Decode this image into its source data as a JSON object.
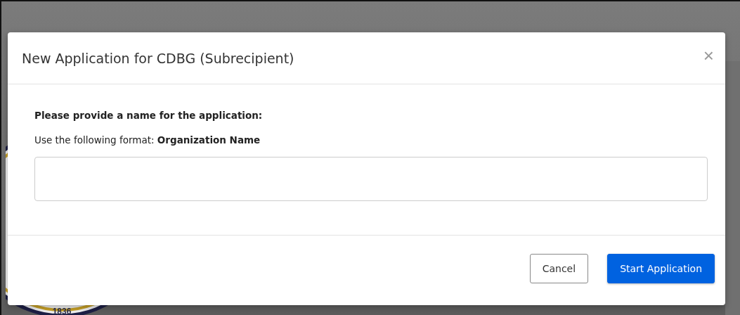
{
  "background": {
    "seal_year": "1836"
  },
  "dialog": {
    "title": "New Application for CDBG (Subrecipient)",
    "close": "×",
    "prompt": "Please provide a name for the application:",
    "format_hint": "Use the following format: **Organization Name**",
    "buttons": [
      {
        "label": "Cancel",
        "kind": "secondary"
      },
      {
        "label": "Start Application",
        "kind": "primary"
      }
    ]
  }
}
